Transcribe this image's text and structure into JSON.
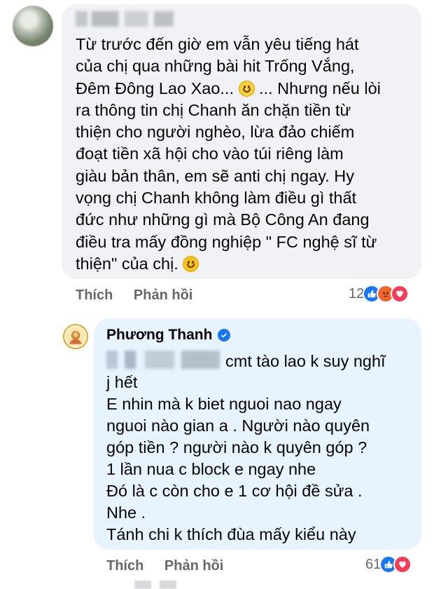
{
  "comment": {
    "text_part1": "Từ trước đến giờ em vẫn yêu tiếng hát\ncủa chị qua những bài hit Trống Vắng,\nĐêm Đông Lao Xao... ",
    "emoji1": "blush-smile-emoji",
    "text_part2": " ... Nhưng nếu lòi\nra thông tin chị Chanh ăn chặn tiền từ\nthiện cho người nghèo, lừa đảo chiếm\nđoạt tiền xã hội cho vào túi riêng làm\ngiàu bản thân, em sẽ anti chị ngay. Hy\nvọng chị Chanh không làm điều gì thất\nđức như những gì mà Bộ Công An đang\nđiều tra mấy đồng nghiệp \" FC nghệ sĩ từ\nthiện\" của chị. ",
    "emoji2": "smile-emoji",
    "like_label": "Thích",
    "reply_label": "Phản hồi",
    "reaction_count": "12",
    "reactions": [
      "like",
      "angry",
      "love"
    ]
  },
  "reply": {
    "author": "Phương Thanh",
    "first_line": "cmt tào lao k suy nghĩ",
    "text": "j hết\nE nhin mà k biet nguoi nao ngay\nnguoi nào gian a . Người nào quyên\ngóp tiền ? người nào k quyên góp ?\n1 lần nua c block e ngay nhe\nĐó là c còn cho e 1 cơ hội đề sửa .\nNhe .\nTánh chi k thích đùa mấy kiểu này",
    "like_label": "Thích",
    "reply_label": "Phản hồi",
    "reaction_count": "61",
    "reactions": [
      "like",
      "love"
    ]
  },
  "colors": {
    "bubble_grey": "#f0f2f5",
    "bubble_blue": "#e7f3ff",
    "like_blue": "#1877f2",
    "angry_orange": "#f0652a",
    "love_red": "#f33e58",
    "action_grey": "#65676b"
  }
}
